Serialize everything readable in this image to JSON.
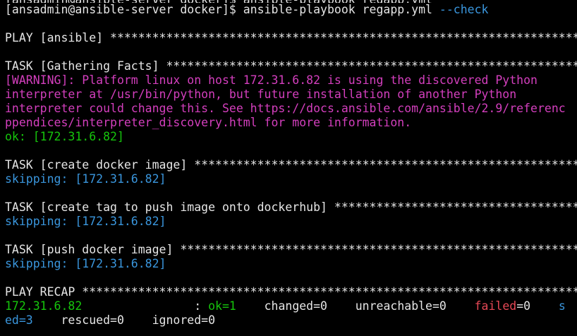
{
  "terminal": {
    "cut_line": "[ansadmin@ansible-server docker]$ ansible-playbook regapp.yml",
    "prompt": "[ansadmin@ansible-server docker]$ ansible-playbook regapp.yml ",
    "flag": "--check",
    "play": "PLAY [ansible] *************************************************************************************",
    "task_facts": "TASK [Gathering Facts] *****************************************************************************",
    "warning": [
      "[WARNING]: Platform linux on host 172.31.6.82 is using the discovered Python",
      "interpreter at /usr/bin/python, but future installation of another Python",
      "interpreter could change this. See https://docs.ansible.com/ansible/2.9/referenc",
      "ppendices/interpreter_discovery.html for more information."
    ],
    "ok_host": "ok: [172.31.6.82]",
    "task_create_image": "TASK [create docker image] *************************************************************************",
    "skip_1": "skipping: [172.31.6.82]",
    "task_tag": "TASK [create tag to push image onto dockerhub] *****************************************************",
    "skip_2": "skipping: [172.31.6.82]",
    "task_push": "TASK [push docker image] ***************************************************************************",
    "skip_3": "skipping: [172.31.6.82]",
    "recap": "PLAY RECAP *****************************************************************************************",
    "recap_row": {
      "host": "172.31.6.82",
      "gap": "                : ",
      "ok": "ok=1",
      "changed": "    changed=0    unreachable=0    ",
      "failed": "failed",
      "failed_val": "=0    ",
      "s": "s"
    },
    "recap_row2": "ed=3    rescued=0    ignored=0"
  },
  "colors": {
    "background": "#000000",
    "text": "#e6e6e6",
    "green": "#16c60c",
    "cyan": "#3a96dd",
    "magenta": "#d43fbe",
    "red": "#e74856"
  }
}
